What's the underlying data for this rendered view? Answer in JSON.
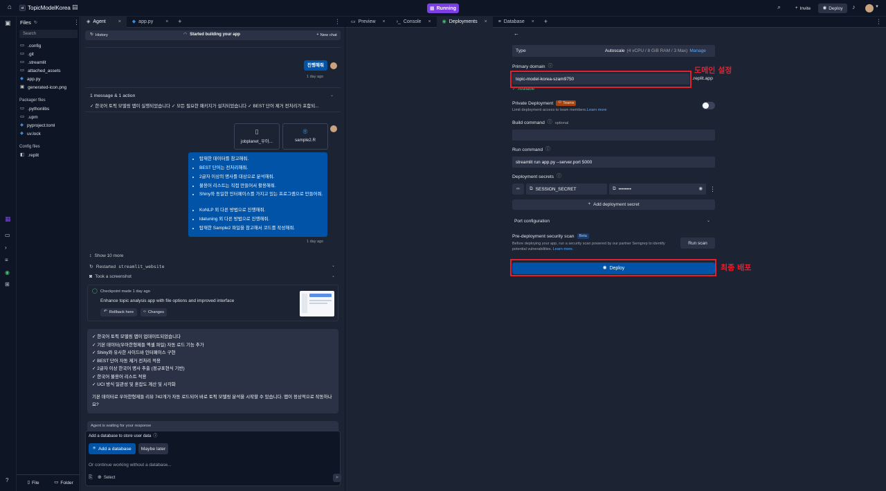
{
  "topbar": {
    "project_name": "TopicModelKorea",
    "status": "Running",
    "invite": "Invite",
    "deploy": "Deploy"
  },
  "files": {
    "title": "Files",
    "search_placeholder": "Search",
    "items": [
      ".config",
      ".git",
      ".streamlit",
      "attached_assets",
      "app.py",
      "generated-icon.png"
    ],
    "packager_title": "Packager files",
    "packager_items": [
      ".pythonlibs",
      ".upm",
      "pyproject.toml",
      "uv.lock"
    ],
    "config_title": "Config files",
    "config_items": [
      ".replit"
    ],
    "file_btn": "File",
    "folder_btn": "Folder"
  },
  "agent": {
    "tab_agent": "Agent",
    "tab_app": "app.py",
    "history": "History",
    "header_status": "Started building your app",
    "new_chat": "New chat",
    "user_msg1": "진행해줘",
    "time1": "1 day ago",
    "action_summary": "1 message & 1 action",
    "action_preview": "✓ 한국어 토픽 모델링 앱이 실행되었습니다 ✓ 모든 필요한 패키지가 설치되었습니다 ✓ BEST 단어 제거 전처리가 포함되...",
    "attach1": "jobplanet_우아...",
    "attach2": "sample2.R",
    "bullets": [
      "탑재한 데이터를 참고해줘.",
      "BEST 단어는 전처리해줘.",
      "2글자 이상의 명사를 대상으로 분석해줘.",
      "불용어 리스트는 직접 만들어서 활용해줘.",
      "Shiny와 동일한 인터페이스를 가지고 있는 프로그램으로 만들어줘.",
      "KoNLP 외 다른 방법으로 진행해줘.",
      "ldatuning 외 다른 방법으로 진행해줘.",
      "탑재한 Sample2 파일을 참고해서 코드를 작성해줘."
    ],
    "time2": "1 day ago",
    "show_more": "Show 10 more",
    "restarted_label": "Restarted",
    "restarted_code": "streamlit_website",
    "screenshot": "Took a screenshot",
    "checkpoint": "Checkpoint made 1 day ago",
    "checkpoint_desc": "Enhance topic analysis app with file options and improved interface",
    "rollback": "Rollback here",
    "changes": "Changes",
    "reply_lines": [
      "✓ 한국어 토픽 모델링 앱이 업데이트되었습니다",
      "✓ 기본 데이터(우아한형제들 엑셀 파일) 자동 로드 기능 추가",
      "✓ Shiny와 유사한 사이드바 인터페이스 구현",
      "✓ BEST 단어 자동 제거 전처리 적용",
      "✓ 2글자 이상 한국어 명사 추출 (정규표현식 기반)",
      "✓ 한국어 불용어 리스트 적용",
      "✓ UCI 방식 일관성 및 혼잡도 계산 및 시각화"
    ],
    "reply_para": "기본 데이터로 우아한형제들 리뷰 742개가 자동 로드되어 바로 토픽 모델링 분석을 시작할 수 있습니다. 앱이 정상적으로 작동하나요?",
    "waiting": "Agent is waiting for your response",
    "db_prompt": "Add a database to store user data",
    "add_db": "Add a database",
    "maybe_later": "Maybe later",
    "input_placeholder": "Or continue working without a database...",
    "select": "Select"
  },
  "right": {
    "tabs": [
      "Preview",
      "Console",
      "Deployments",
      "Database"
    ],
    "type_label": "Type",
    "type_value": "Autoscale",
    "type_spec": "(4 vCPU / 8 GiB RAM / 3 Max)",
    "manage": "Manage",
    "primary_domain": "Primary domain",
    "domain_value": "topic-model-korea-szam9750",
    "domain_suffix": ".replit.app",
    "available": "Available",
    "private_deploy": "Private Deployment",
    "teams": "Teams",
    "private_desc": "Limit deployment access to team members.",
    "learn_more": "Learn more",
    "build_command": "Build command",
    "optional": "optional",
    "run_command": "Run command",
    "run_value": "streamlit run app.py --server.port 5000",
    "secrets": "Deployment secrets",
    "secret_key": "SESSION_SECRET",
    "secret_value": "••••••••",
    "add_secret": "Add deployment secret",
    "port_config": "Port configuration",
    "scan_title": "Pre-deployment security scan",
    "beta": "Beta",
    "scan_desc": "Before deploying your app, run a security scan powered by our partner Semgrep to identify potential vulnerabilities.",
    "scan_learn": "Learn more.",
    "run_scan": "Run scan",
    "deploy_btn": "Deploy"
  },
  "annotations": {
    "domain_note": "도메인 설정",
    "deploy_note": "최종 배포"
  },
  "colors": {
    "accent": "#0053a6",
    "running": "#7b3fe4",
    "annotation": "#e5202e"
  }
}
